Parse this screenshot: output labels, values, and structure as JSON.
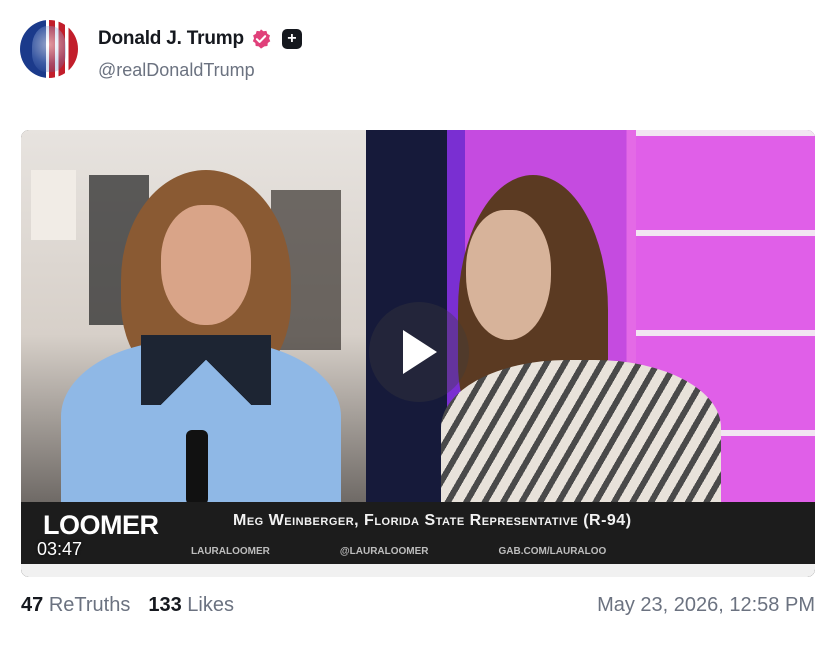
{
  "post": {
    "author": {
      "name": "Donald J. Trump",
      "handle": "@realDonaldTrump",
      "verified_icon": "verified-badge-icon",
      "plus_icon": "plus-badge-icon",
      "verified_color": "#e0407a"
    },
    "video": {
      "duration": "03:47",
      "channel_logo": "LOOMER",
      "lower_third_caption": "Meg Weinberger, Florida State Representative (R-94)",
      "socials": [
        "LAURALOOMER",
        "@LAURALOOMER",
        "GAB.COM/LAURALOO"
      ]
    },
    "stats": {
      "retruths_count": "47",
      "retruths_label": "ReTruths",
      "likes_count": "133",
      "likes_label": "Likes"
    },
    "timestamp": "May 23, 2026, 12:58 PM"
  }
}
